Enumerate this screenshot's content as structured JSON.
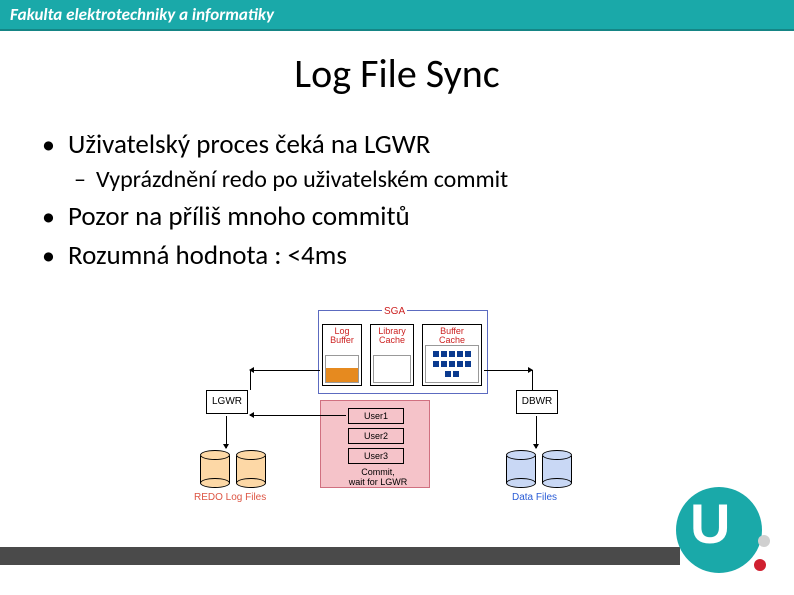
{
  "header": {
    "faculty": "Fakulta elektrotechniky a informatiky"
  },
  "title": "Log File Sync",
  "bullets": {
    "b1": "Uživatelský proces čeká na LGWR",
    "b1_sub1": "Vyprázdnění redo po uživatelském commit",
    "b2": "Pozor na příliš mnoho commitů",
    "b3": "Rozumná hodnota : <4ms"
  },
  "diagram": {
    "sga": "SGA",
    "log_buffer": "Log\nBuffer",
    "library_cache": "Library\nCache",
    "buffer_cache": "Buffer\nCache",
    "lgwr": "LGWR",
    "dbwr": "DBWR",
    "user1": "User1",
    "user2": "User2",
    "user3": "User3",
    "commit_wait": "Commit,\nwait for LGWR",
    "redo_files": "REDO Log Files",
    "data_files": "Data Files"
  },
  "logo": {
    "letter": "U"
  }
}
